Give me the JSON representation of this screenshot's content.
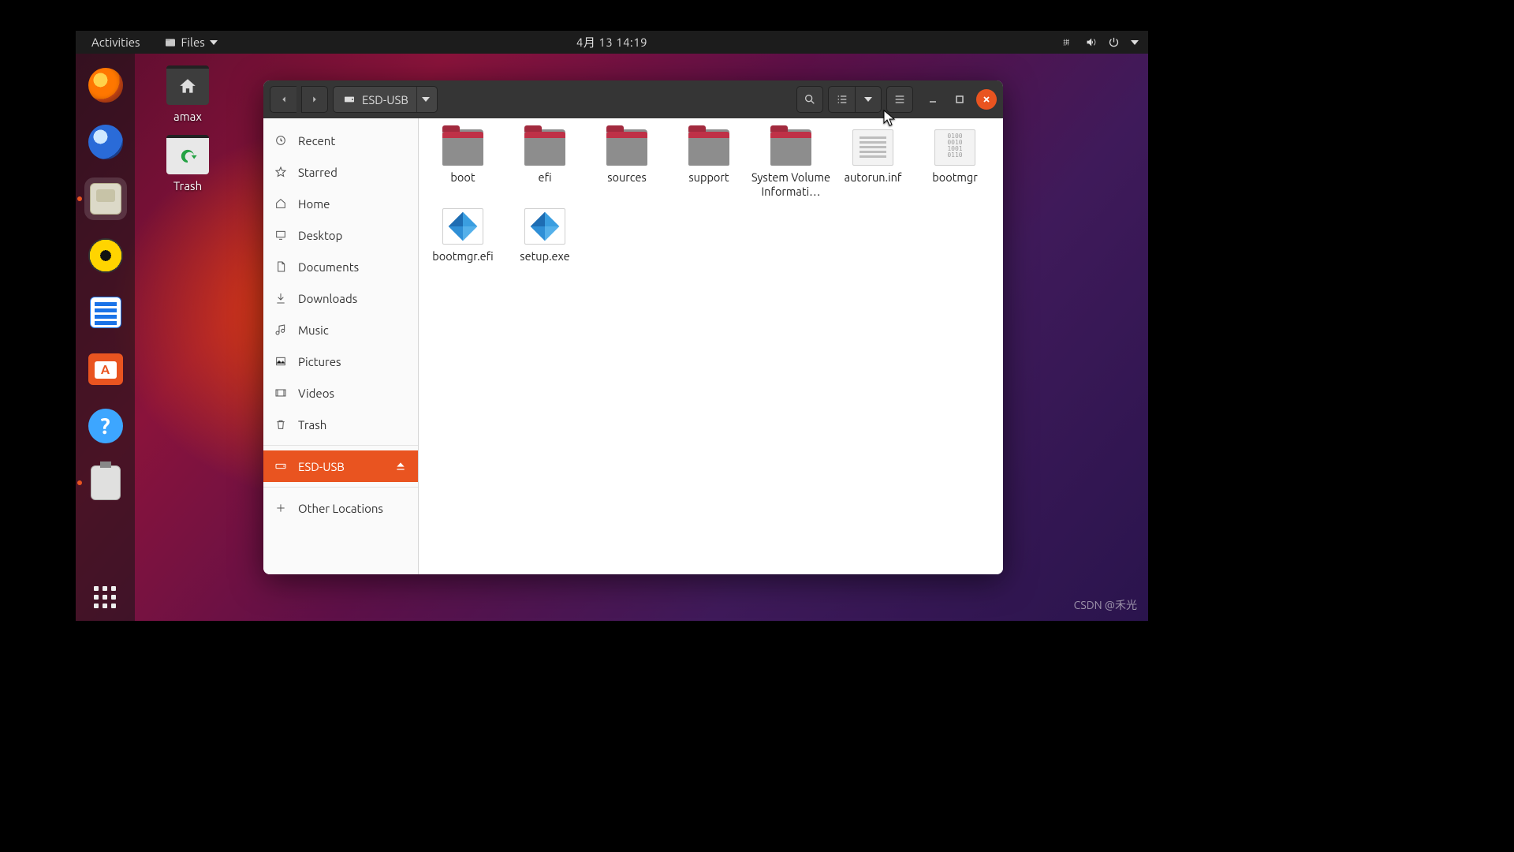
{
  "topbar": {
    "activities": "Activities",
    "app_menu": "Files",
    "clock": "4月 13  14:19"
  },
  "desktop": {
    "home_label": "amax",
    "trash_label": "Trash"
  },
  "fm": {
    "location": "ESD-USB",
    "sidebar": {
      "recent": "Recent",
      "starred": "Starred",
      "home": "Home",
      "desktop": "Desktop",
      "documents": "Documents",
      "downloads": "Downloads",
      "music": "Music",
      "pictures": "Pictures",
      "videos": "Videos",
      "trash": "Trash",
      "esd_usb": "ESD-USB",
      "other": "Other Locations"
    },
    "items": {
      "boot": "boot",
      "efi": "efi",
      "sources": "sources",
      "support": "support",
      "svi": "System Volume Informati…",
      "autorun": "autorun.inf",
      "bootmgr": "bootmgr",
      "bootmgr_efi": "bootmgr.efi",
      "setup": "setup.exe"
    }
  },
  "watermark": "CSDN @禾光"
}
